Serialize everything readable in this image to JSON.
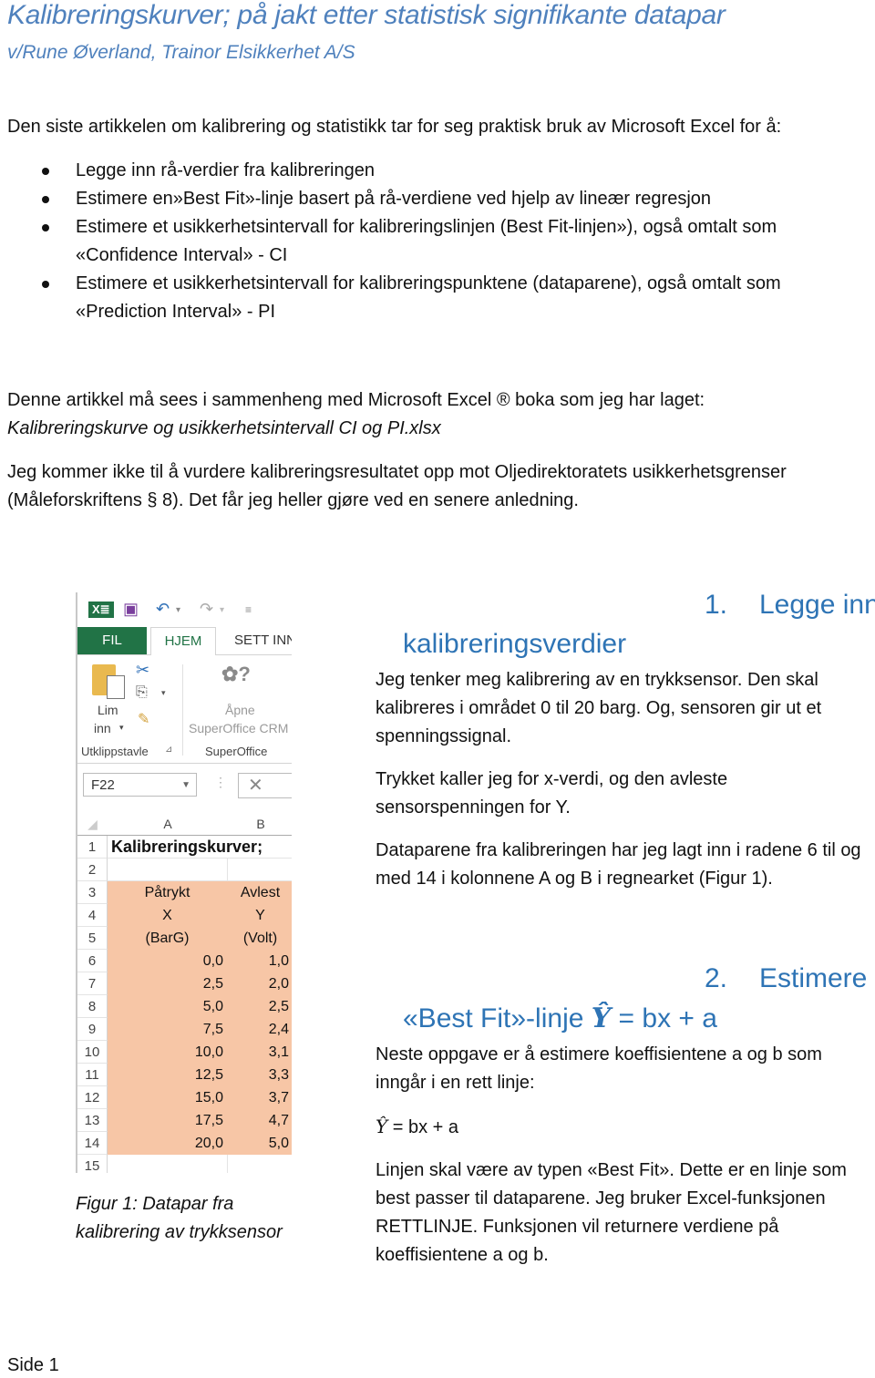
{
  "document": {
    "title": "Kalibreringskurver; på jakt etter statistisk signifikante datapar",
    "subtitle": "v/Rune Øverland, Trainor Elsikkerhet A/S",
    "intro": "Den siste artikkelen om kalibrering og statistikk tar for seg praktisk bruk av Microsoft Excel for å:",
    "bullets": [
      "Legge inn rå-verdier fra kalibreringen",
      "Estimere en»Best Fit»-linje basert på rå-verdiene ved hjelp av lineær regresjon",
      "Estimere et usikkerhetsintervall for kalibreringslinjen (Best Fit-linjen»), også omtalt som «Confidence Interval» - CI",
      "Estimere et usikkerhetsintervall for kalibreringspunktene (dataparene), også omtalt som «Prediction Interval» - PI"
    ],
    "para1_text": "Denne artikkel må sees i sammenheng med Microsoft Excel ® boka som jeg har laget:",
    "para1_file": "Kalibreringskurve og usikkerhetsintervall CI og PI.xlsx",
    "para2": "Jeg kommer ikke til å vurdere kalibreringsresultatet opp mot Oljedirektoratets usikkerhetsgrenser (Måleforskriftens § 8). Det får jeg heller gjøre ved en senere anledning.",
    "figure_caption": "Figur 1: Datapar fra kalibrering av trykksensor",
    "footer": "Side 1"
  },
  "excel": {
    "tabs": {
      "fil": "FIL",
      "hjem": "HJEM",
      "sett_inn": "SETT INN"
    },
    "ribbon": {
      "paste_label_1": "Lim",
      "paste_label_2": "inn",
      "clipboard_group": "Utklippstavle",
      "superoffice_btn_1": "Åpne",
      "superoffice_btn_2": "SuperOffice CRM",
      "superoffice_group": "SuperOffice"
    },
    "name_box": "F22",
    "columns": [
      "A",
      "B"
    ],
    "rows": [
      {
        "n": "1",
        "a": "Kalibreringskurver;",
        "b": ""
      },
      {
        "n": "2",
        "a": "",
        "b": ""
      },
      {
        "n": "3",
        "a": "Påtrykt",
        "b": "Avlest"
      },
      {
        "n": "4",
        "a": "X",
        "b": "Y"
      },
      {
        "n": "5",
        "a": "(BarG)",
        "b": "(Volt)"
      },
      {
        "n": "6",
        "a": "0,0",
        "b": "1,0"
      },
      {
        "n": "7",
        "a": "2,5",
        "b": "2,0"
      },
      {
        "n": "8",
        "a": "5,0",
        "b": "2,5"
      },
      {
        "n": "9",
        "a": "7,5",
        "b": "2,4"
      },
      {
        "n": "10",
        "a": "10,0",
        "b": "3,1"
      },
      {
        "n": "11",
        "a": "12,5",
        "b": "3,3"
      },
      {
        "n": "12",
        "a": "15,0",
        "b": "3,7"
      },
      {
        "n": "13",
        "a": "17,5",
        "b": "4,7"
      },
      {
        "n": "14",
        "a": "20,0",
        "b": "5,0"
      },
      {
        "n": "15",
        "a": "",
        "b": ""
      }
    ],
    "highlight_color": "#f7c6a6"
  },
  "section1": {
    "number": "1.",
    "title_word": "Legge inn",
    "title_cont": "kalibreringsverdier",
    "p1": "Jeg tenker meg kalibrering av en trykksensor. Den skal kalibreres i området 0 til 20 barg. Og, sensoren gir ut et spenningssignal.",
    "p2": "Trykket kaller jeg for x-verdi, og den avleste sensorspenningen for Y.",
    "p3": "Dataparene fra kalibreringen har jeg lagt inn i radene 6 til og med 14 i kolonnene A og B i regnearket (Figur 1)."
  },
  "section2": {
    "number": "2.",
    "title_word": "Estimere",
    "title_cont_pre": "«Best Fit»-linje",
    "title_cont_symbol": "Ŷ",
    "title_cont_post": "= bx + a",
    "p1": "Neste oppgave er å estimere koeffisientene a og b som inngår i en rett linje:",
    "formula_symbol": "Ŷ",
    "formula_rest": "= bx + a",
    "p2": "Linjen skal være av typen «Best Fit». Dette er en linje som best passer til dataparene. Jeg bruker Excel-funksjonen RETTLINJE. Funksjonen vil returnere verdiene på koeffisientene a og b."
  },
  "colors": {
    "heading_blue": "#2e74b5",
    "title_blue": "#4f81bd",
    "excel_green": "#217346"
  }
}
